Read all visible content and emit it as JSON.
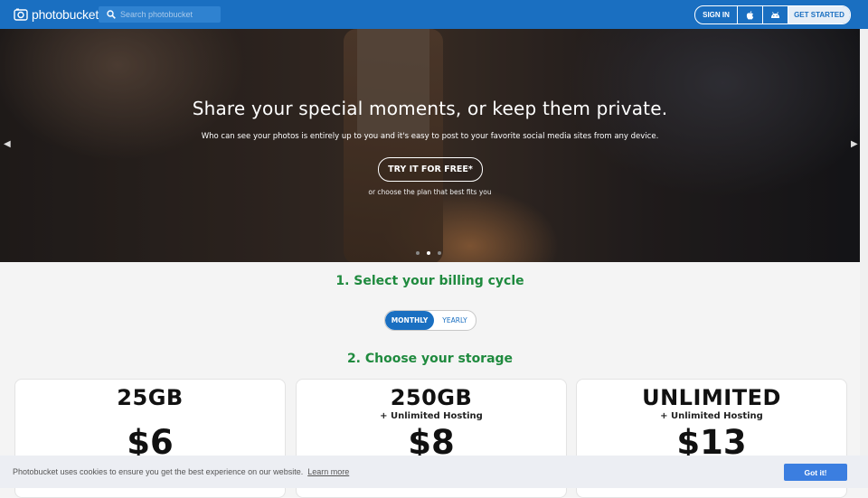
{
  "header": {
    "logo_text": "photobucket",
    "search_placeholder": "Search photobucket",
    "sign_in": "SIGN IN",
    "get_started": "GET STARTED",
    "apple_icon": "apple-icon",
    "android_icon": "android-icon"
  },
  "hero": {
    "title": "Share your special moments, or keep them private.",
    "subtitle": "Who can see your photos is entirely up to you and it's easy to post to your favorite social media sites from any device.",
    "cta": "TRY IT FOR FREE*",
    "note": "or choose the plan that best fits you",
    "active_slide": 2,
    "slide_count": 3
  },
  "pricing": {
    "step1_title": "1. Select your billing cycle",
    "billing_options": [
      "MONTHLY",
      "YEARLY"
    ],
    "billing_selected": "MONTHLY",
    "step2_title": "2. Choose your storage",
    "plans": [
      {
        "storage": "25GB",
        "extra": "",
        "price": "$6"
      },
      {
        "storage": "250GB",
        "extra": "+ Unlimited Hosting",
        "price": "$8"
      },
      {
        "storage": "UNLIMITED",
        "extra": "+ Unlimited Hosting",
        "price": "$13"
      }
    ]
  },
  "cookie": {
    "text": "Photobucket uses cookies to ensure you get the best experience on our website.",
    "link": "Learn more",
    "button": "Got it!"
  },
  "colors": {
    "brand_blue": "#1a6fc1",
    "green_heading": "#1f8a3e",
    "cookie_button": "#3b7ee0"
  }
}
